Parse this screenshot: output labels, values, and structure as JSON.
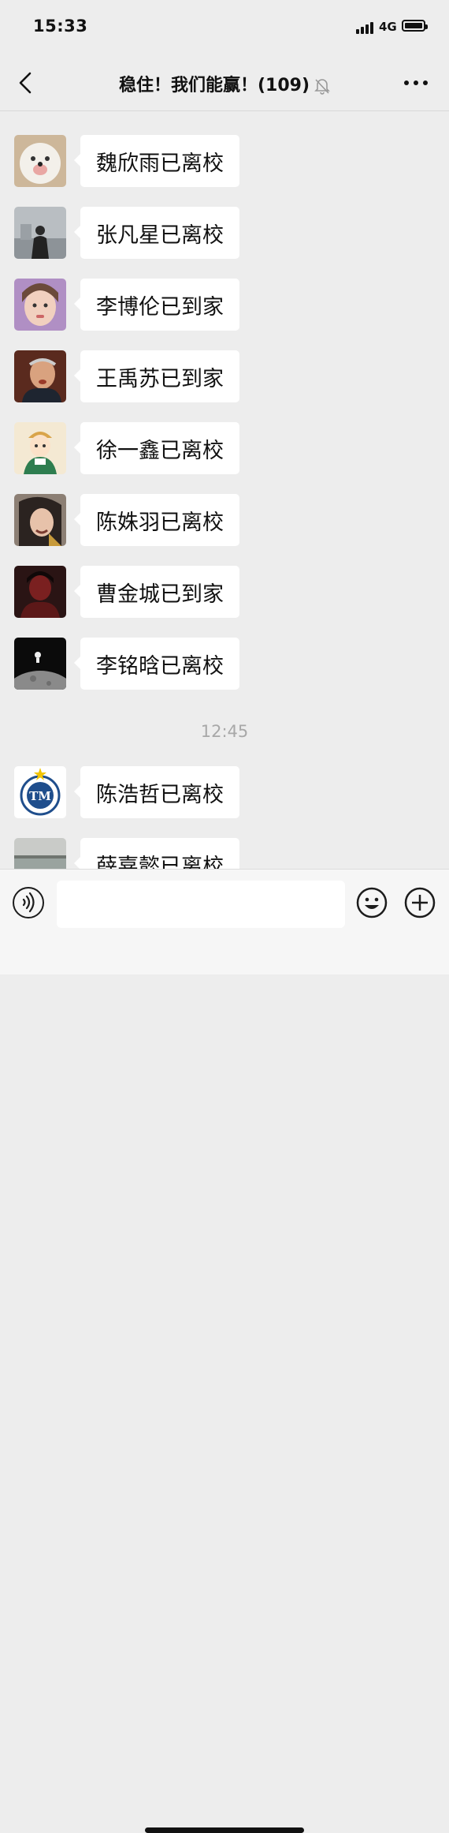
{
  "status": {
    "time": "15:33",
    "network": "4G"
  },
  "header": {
    "title": "稳住！我们能赢！(109)",
    "back_icon": "chevron-left-icon",
    "mute_icon": "bell-off-icon",
    "more_icon": "more-dots-icon"
  },
  "messages": [
    {
      "text": "魏欣雨已离校",
      "avatar": "avatar-dog"
    },
    {
      "text": "张凡星已离校",
      "avatar": "avatar-person-river"
    },
    {
      "text": "李博伦已到家",
      "avatar": "avatar-girl"
    },
    {
      "text": "王禹苏已到家",
      "avatar": "avatar-man"
    },
    {
      "text": "徐一鑫已离校",
      "avatar": "avatar-cartoon-girl"
    },
    {
      "text": "陈姝羽已离校",
      "avatar": "avatar-crying-girl"
    },
    {
      "text": "曹金城已到家",
      "avatar": "avatar-dark-portrait"
    },
    {
      "text": "李铭晗已离校",
      "avatar": "avatar-astronaut-moon"
    },
    {
      "text": "陈浩哲已离校",
      "avatar": "avatar-school-logo"
    },
    {
      "text": "薛嘉懿已离校",
      "avatar": "avatar-lake"
    }
  ],
  "timestamp": "12:45",
  "logo_text": "TM",
  "input": {
    "placeholder": "",
    "voice_icon": "voice-icon",
    "emoji_icon": "emoji-icon",
    "plus_icon": "plus-icon"
  }
}
